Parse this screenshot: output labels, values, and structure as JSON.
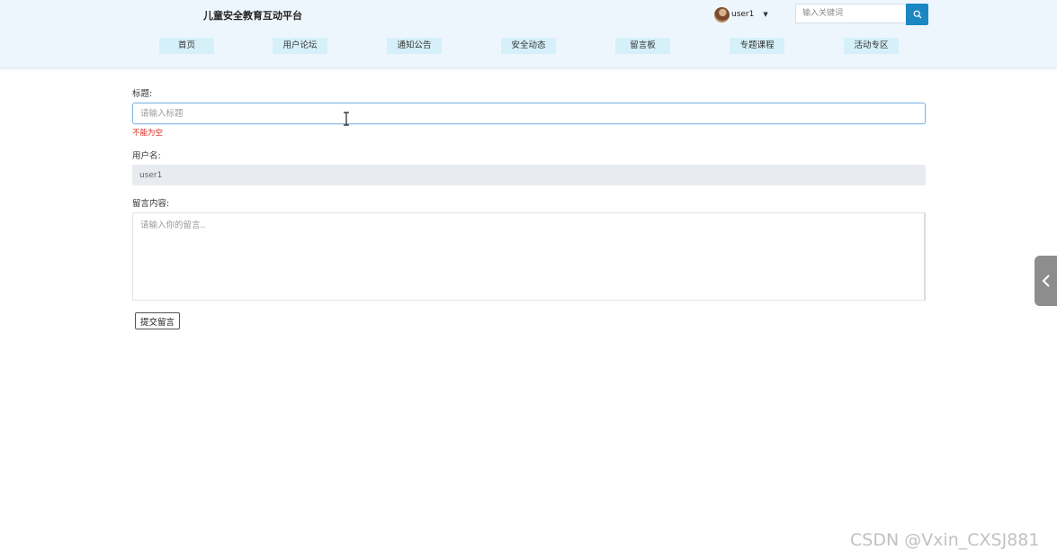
{
  "header": {
    "site_title": "儿童安全教育互动平台",
    "user": {
      "name": "user1"
    },
    "search": {
      "placeholder": "输入关键词"
    },
    "nav": [
      "首页",
      "用户论坛",
      "通知公告",
      "安全动态",
      "留言板",
      "专题课程",
      "活动专区"
    ]
  },
  "form": {
    "title_label": "标题:",
    "title_placeholder": "请输入标题",
    "title_error": "不能为空",
    "username_label": "用户名:",
    "username_value": "user1",
    "content_label": "留言内容:",
    "content_placeholder": "请输入你的留言..",
    "submit_label": "提交留言"
  },
  "watermark": "CSDN @Vxin_CXSJ881",
  "colors": {
    "accent": "#1b87c2",
    "nav_bg": "#d6f0fa",
    "header_bg": "#eef6fd",
    "error": "#d9281e"
  }
}
